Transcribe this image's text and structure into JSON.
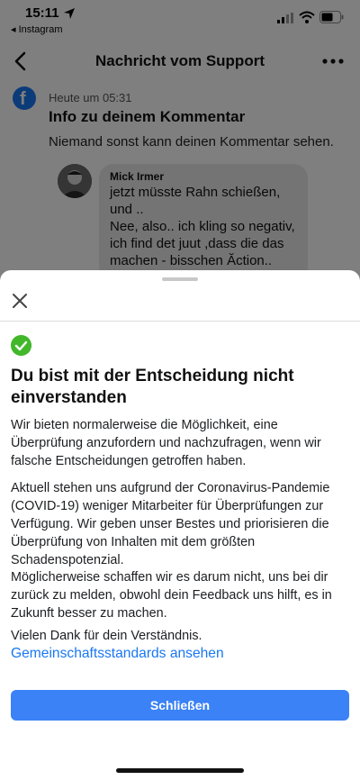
{
  "status_bar": {
    "time": "15:11",
    "back_app": "◂ Instagram"
  },
  "nav": {
    "title": "Nachricht vom Support"
  },
  "message": {
    "logo_letter": "f",
    "time": "Heute um 05:31",
    "heading": "Info zu deinem Kommentar",
    "text": "Niemand sonst kann deinen Kommentar sehen."
  },
  "comment": {
    "author": "Mick Irmer",
    "lines": [
      "jetzt müsste Rahn schießen,",
      "und ..",
      "Nee, also.. ich kling so negativ,",
      "ich find det juut ,dass die das",
      "machen - bisschen Ăction.."
    ]
  },
  "sheet": {
    "title": "Du bist mit der Entscheidung nicht einverstanden",
    "paragraphs": [
      "Wir bieten normalerweise die Möglichkeit, eine Überprüfung anzufordern und nachzufragen, wenn wir falsche Entscheidungen getroffen haben.",
      "Aktuell stehen uns aufgrund der Coronavirus-Pandemie (COVID-19) weniger Mitarbeiter für Überprüfungen zur Verfügung. Wir geben unser Bestes und priorisieren die Überprüfung von Inhalten mit dem größten Schadenspotenzial.",
      "Möglicherweise schaffen wir es darum nicht, uns bei dir zurück zu melden, obwohl dein Feedback uns hilft, es in Zukunft besser zu machen.",
      "Vielen Dank für dein Verständnis."
    ],
    "link_label": "Gemeinschaftsstandards ansehen",
    "button_label": "Schließen"
  },
  "colors": {
    "accent": "#1877f2",
    "button": "#3b82f6",
    "success": "#42b72a"
  }
}
